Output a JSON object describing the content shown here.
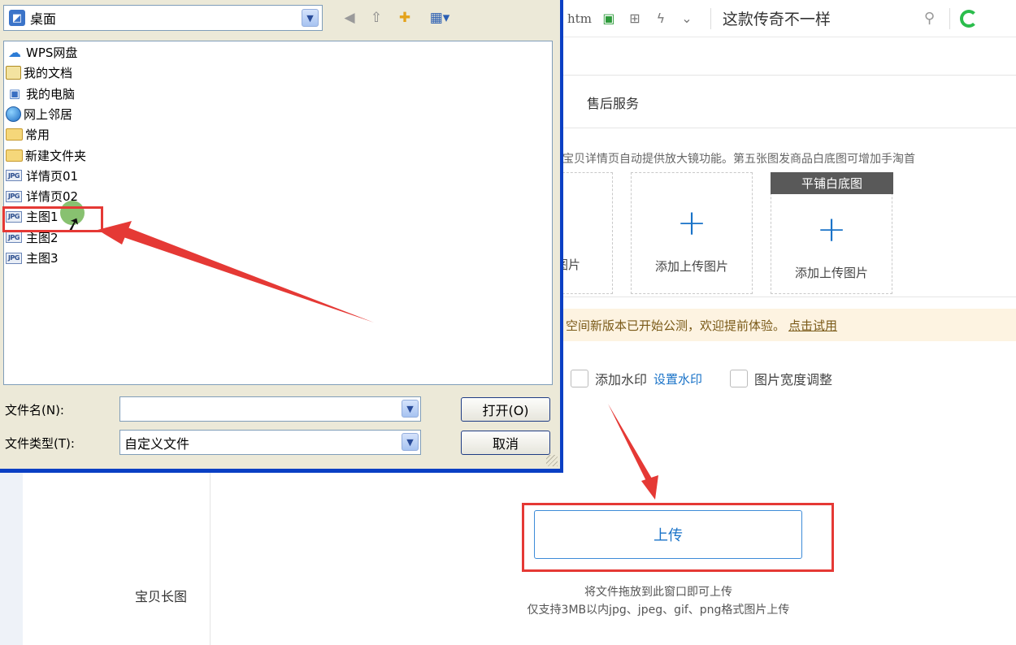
{
  "topbar": {
    "url_fragment": "htm",
    "search_text": "这款传奇不一样"
  },
  "page": {
    "tab_after_sales": "售后服务",
    "image_hint": "宝贝详情页自动提供放大镜功能。第五张图发商品白底图可增加手淘首",
    "slots": {
      "partial_caption": "图片",
      "add_caption": "添加上传图片",
      "white_bg_header": "平铺白底图"
    },
    "notice": {
      "text": "空间新版本已开始公测，欢迎提前体验。",
      "link": "点击试用"
    },
    "options": {
      "add_watermark": "添加水印",
      "set_watermark": "设置水印",
      "adjust_width": "图片宽度调整"
    },
    "upload_button": "上传",
    "drop_hint_1": "将文件拖放到此窗口即可上传",
    "drop_hint_2": "仅支持3MB以内jpg、jpeg、gif、png格式图片上传",
    "long_image_label": "宝贝长图"
  },
  "dialog": {
    "look_in": "桌面",
    "items": [
      {
        "name": "WPS网盘",
        "icon": "cloud-icon"
      },
      {
        "name": "我的文档",
        "icon": "documents-icon"
      },
      {
        "name": "我的电脑",
        "icon": "computer-icon"
      },
      {
        "name": "网上邻居",
        "icon": "network-icon"
      },
      {
        "name": "常用",
        "icon": "folder-icon"
      },
      {
        "name": "新建文件夹",
        "icon": "folder-icon"
      },
      {
        "name": "详情页01",
        "icon": "jpg-file-icon"
      },
      {
        "name": "详情页02",
        "icon": "jpg-file-icon"
      },
      {
        "name": "主图1",
        "icon": "jpg-file-icon"
      },
      {
        "name": "主图2",
        "icon": "jpg-file-icon"
      },
      {
        "name": "主图3",
        "icon": "jpg-file-icon"
      }
    ],
    "jpg_badge": "JPG",
    "file_name_label": "文件名(N):",
    "file_name_value": "",
    "file_type_label": "文件类型(T):",
    "file_type_value": "自定义文件",
    "open_button": "打开(O)",
    "cancel_button": "取消"
  }
}
